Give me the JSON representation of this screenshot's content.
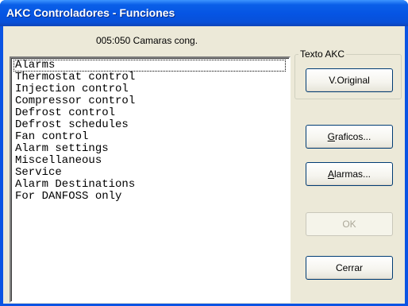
{
  "window": {
    "title": "AKC Controladores - Funciones"
  },
  "subtitle": "005:050  Camaras cong.",
  "list": {
    "items": [
      "Alarms",
      "Thermostat control",
      "Injection control",
      "Compressor control",
      "Defrost control",
      "Defrost schedules",
      "Fan control",
      "Alarm settings",
      "Miscellaneous",
      "Service",
      "Alarm Destinations",
      "For DANFOSS only"
    ],
    "focused_index": 0
  },
  "texto_akc": {
    "label": "Texto AKC",
    "button": "V.Original"
  },
  "buttons": {
    "graficos": {
      "mnemonic": "G",
      "rest": "raficos..."
    },
    "alarmas": {
      "mnemonic": "A",
      "rest": "larmas..."
    },
    "ok": "OK",
    "cerrar": "Cerrar"
  },
  "colors": {
    "titlebar": "#0554e3",
    "dialog_face": "#ece9d8",
    "button_border": "#003c74",
    "disabled_text": "#aca899"
  }
}
